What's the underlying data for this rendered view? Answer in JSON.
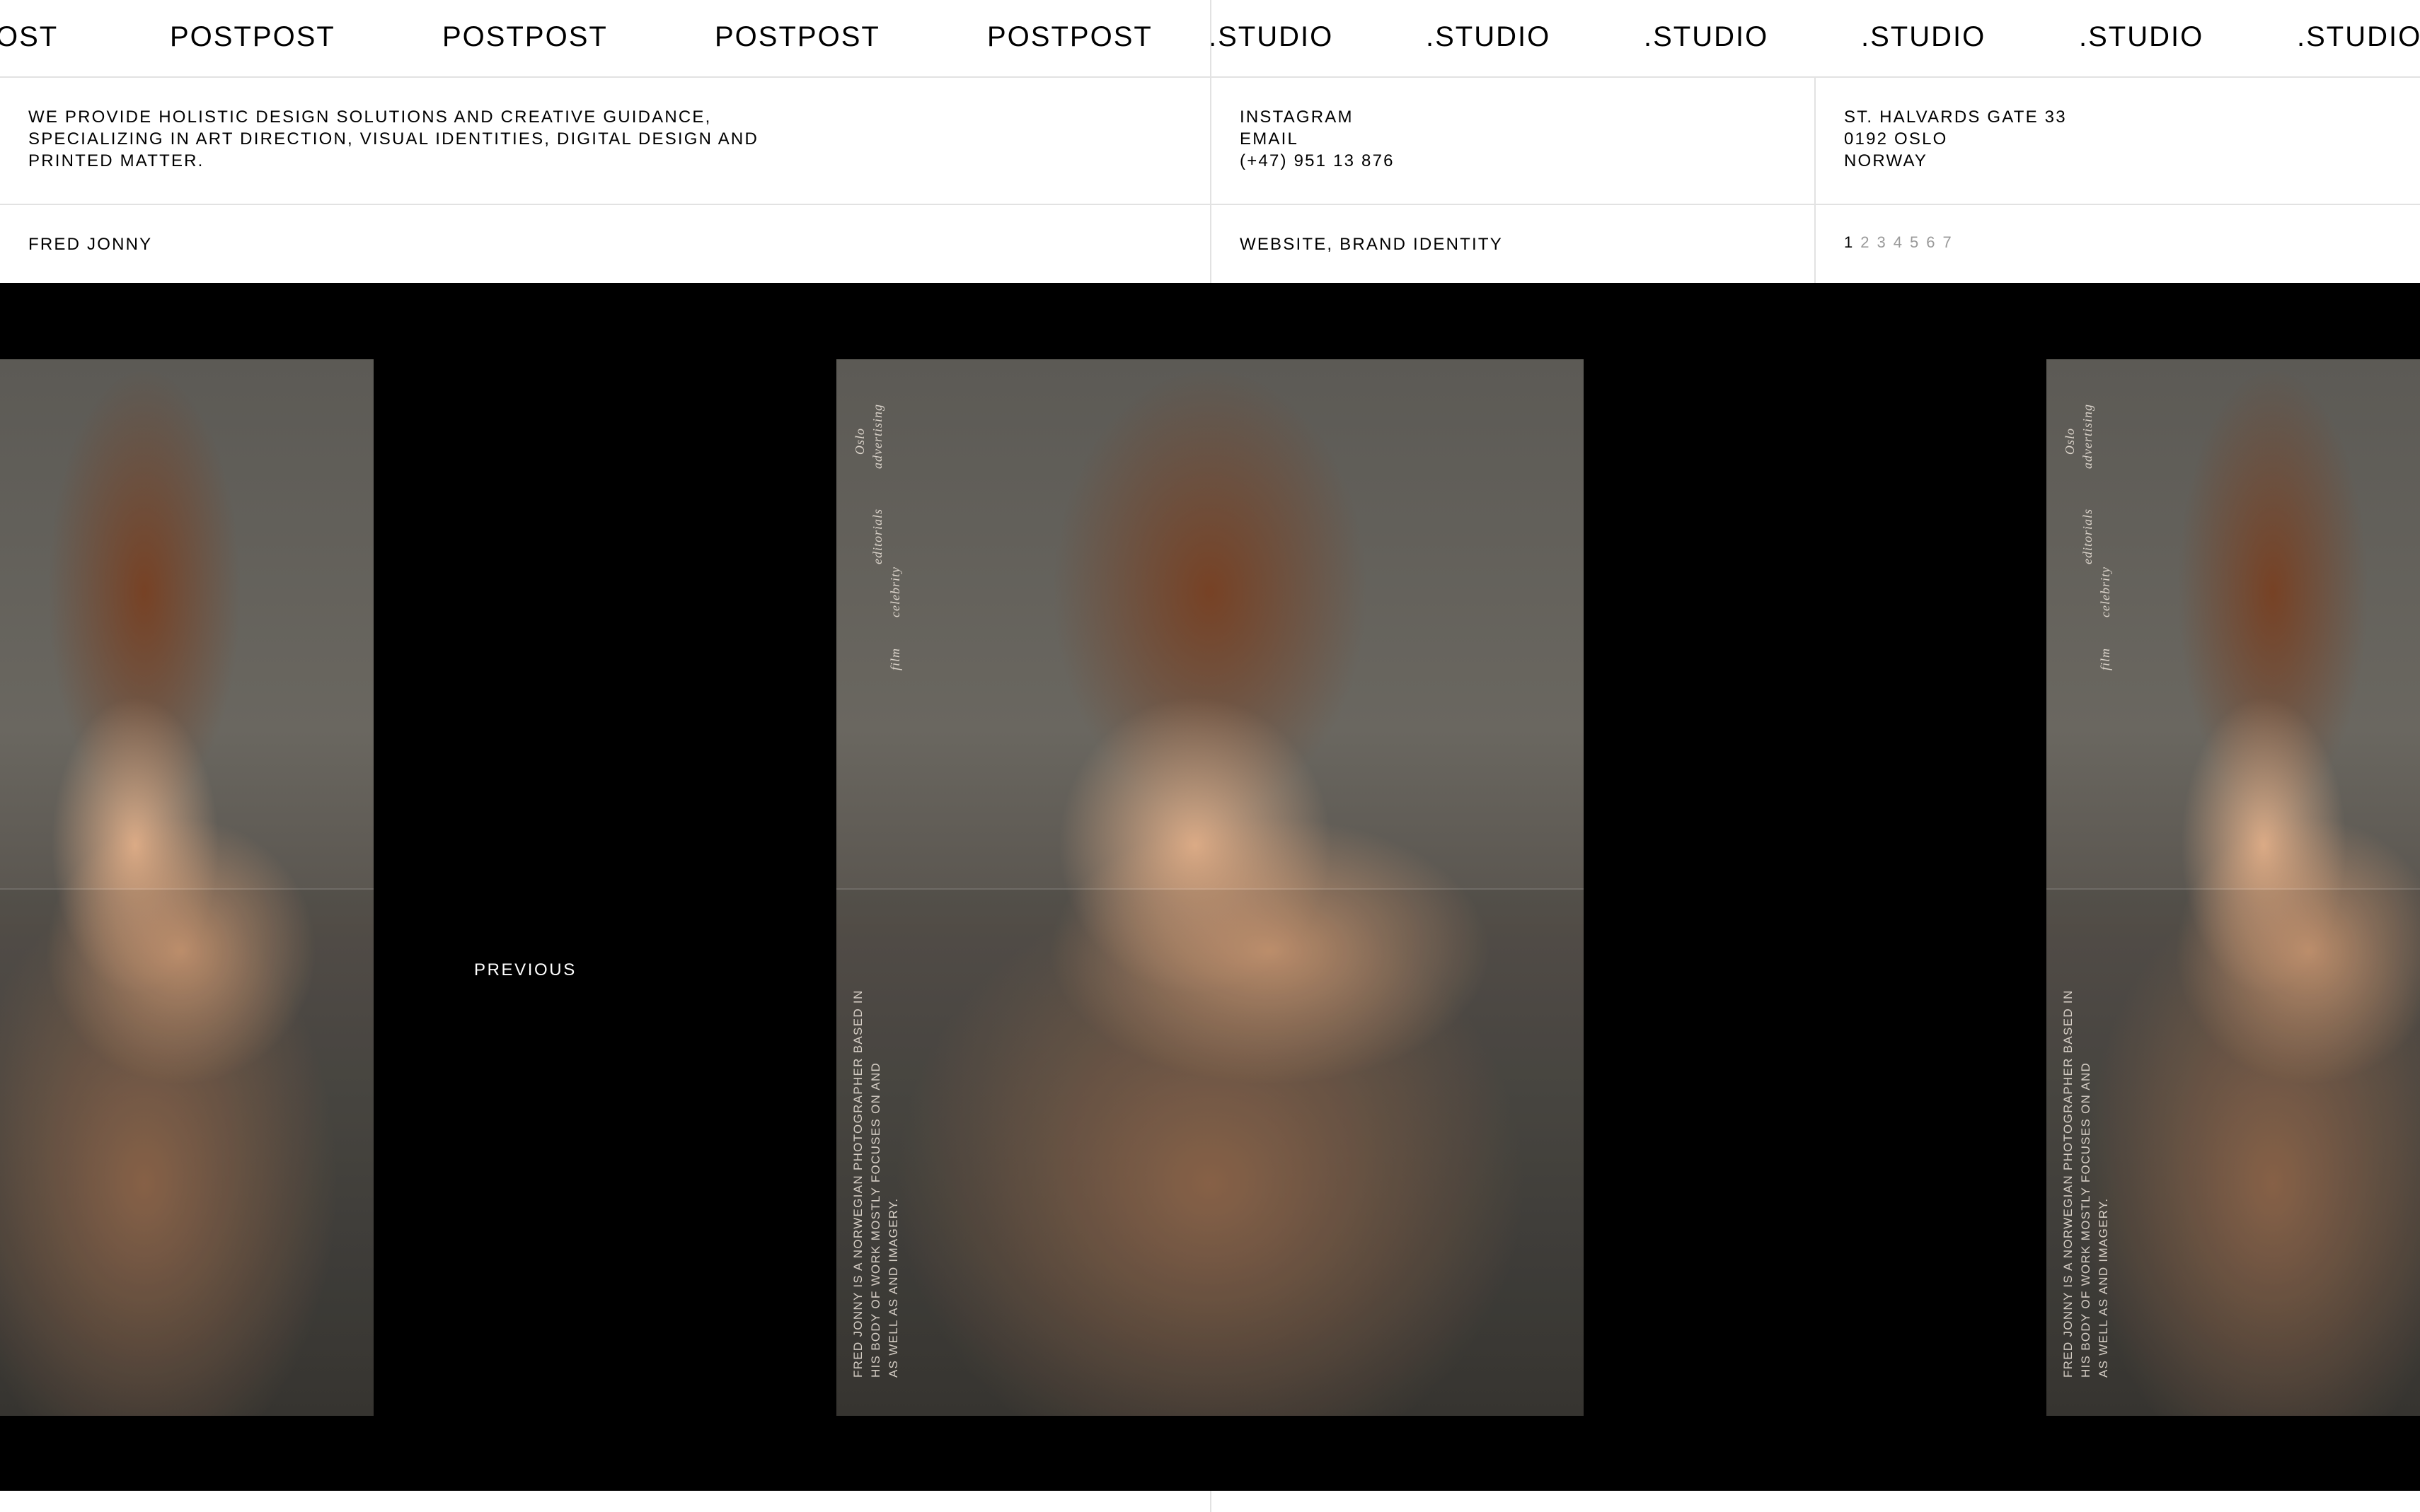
{
  "marquee": {
    "postpost": [
      "OST",
      "POSTPOST",
      "POSTPOST",
      "POSTPOST",
      "POSTPOST"
    ],
    "studio": [
      ".STUDIO",
      ".STUDIO",
      ".STUDIO",
      ".STUDIO",
      ".STUDIO",
      ".STUDIO"
    ]
  },
  "info": {
    "description": [
      "WE PROVIDE HOLISTIC DESIGN SOLUTIONS AND CREATIVE GUIDANCE,",
      "SPECIALIZING IN ART DIRECTION, VISUAL IDENTITIES, DIGITAL DESIGN AND",
      "PRINTED MATTER."
    ],
    "contact": {
      "instagram": "INSTAGRAM",
      "email": "EMAIL",
      "phone": "(+47) 951 13 876"
    },
    "address": [
      "ST. HALVARDS GATE 33",
      "0192 OSLO",
      "NORWAY"
    ]
  },
  "project": {
    "client": "FRED JONNY",
    "services": "WEBSITE, BRAND IDENTITY",
    "pages": [
      "1",
      "2",
      "3",
      "4",
      "5",
      "6",
      "7"
    ],
    "active_page": "1"
  },
  "slides": {
    "previous_label": "PREVIOUS",
    "poster_keywords": {
      "col1": [
        "Oslo",
        "film"
      ],
      "col2": [
        "advertising",
        "editorials",
        "celebrity"
      ]
    },
    "poster_bio": [
      "FRED JONNY IS A NORWEGIAN PHOTOGRAPHER BASED IN",
      "HIS BODY OF WORK MOSTLY FOCUSES ON          AND",
      "AS WELL AS          AND          IMAGERY."
    ]
  },
  "colors": {
    "background": "#ffffff",
    "stage": "#000000",
    "divider": "#e2e2e2",
    "inactive_page": "#9a9a9a"
  }
}
